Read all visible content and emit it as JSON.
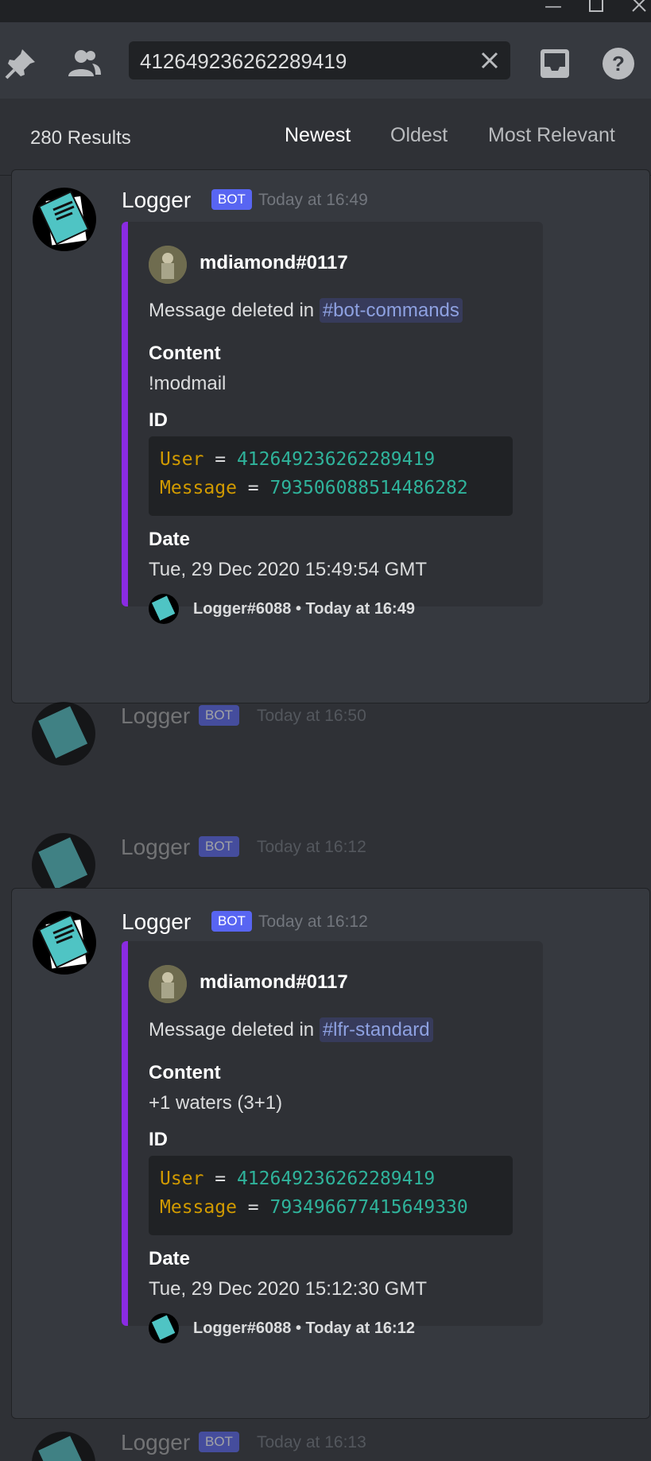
{
  "search": {
    "query": "412649236262289419"
  },
  "results_header": {
    "count": "280 Results",
    "tabs": [
      {
        "label": "Newest"
      },
      {
        "label": "Oldest"
      },
      {
        "label": "Most Relevant"
      }
    ]
  },
  "results": [
    {
      "username": "Logger",
      "badge": "BOT",
      "timestamp": "Today at 16:49",
      "embed": {
        "author": "mdiamond#0117",
        "desc_prefix": "Message deleted in ",
        "channel": "#bot-commands",
        "content_label": "Content",
        "content_value": "!modmail",
        "id_label": "ID",
        "user_key": "User",
        "user_id": "412649236262289419",
        "message_key": "Message",
        "message_id": "793506088514486282",
        "date_label": "Date",
        "date_value": "Tue, 29 Dec 2020 15:49:54 GMT",
        "footer": "Logger#6088 • Today at 16:49"
      }
    },
    {
      "username": "Logger",
      "badge": "BOT",
      "timestamp": "Today at 16:12",
      "embed": {
        "author": "mdiamond#0117",
        "desc_prefix": "Message deleted in ",
        "channel": "#lfr-standard",
        "content_label": "Content",
        "content_value": "+1 waters (3+1)",
        "id_label": "ID",
        "user_key": "User",
        "user_id": "412649236262289419",
        "message_key": "Message",
        "message_id": "793496677415649330",
        "date_label": "Date",
        "date_value": "Tue, 29 Dec 2020 15:12:30 GMT",
        "footer": "Logger#6088 • Today at 16:12"
      }
    }
  ],
  "context_messages": [
    {
      "username": "Logger",
      "badge": "BOT",
      "timestamp": "Today at 16:50"
    },
    {
      "username": "Logger",
      "badge": "BOT",
      "timestamp": "Today at 16:12"
    },
    {
      "username": "Logger",
      "badge": "BOT",
      "timestamp": "Today at 16:13"
    }
  ],
  "colors": {
    "accent": "#5865f2",
    "embed_border": "#8a2be2",
    "code_key": "#d19a00",
    "code_value": "#2fb39b"
  }
}
